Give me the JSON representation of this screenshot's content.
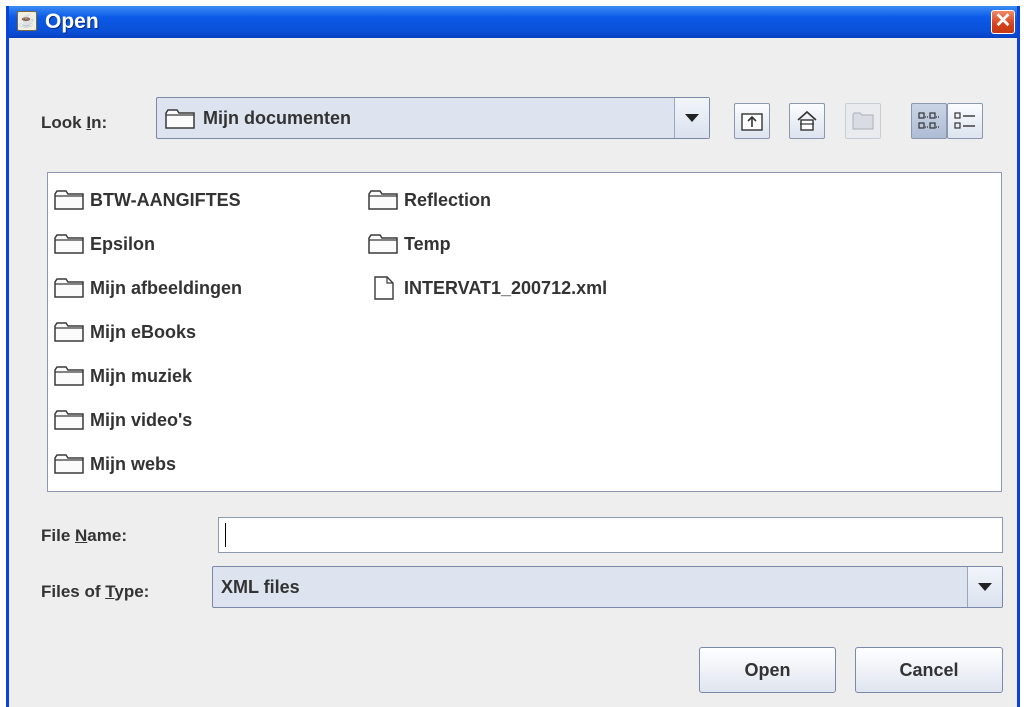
{
  "window": {
    "title": "Open"
  },
  "look_in": {
    "label_pre": "Look ",
    "label_mnemonic": "I",
    "label_post": "n:",
    "value": "Mijn documenten"
  },
  "toolbar": [
    {
      "name": "up-one-level",
      "icon": "up-folder-icon",
      "enabled": true,
      "selected": false
    },
    {
      "name": "home",
      "icon": "home-icon",
      "enabled": true,
      "selected": false
    },
    {
      "name": "new-folder",
      "icon": "new-folder-icon",
      "enabled": false,
      "selected": false
    },
    {
      "name": "list-view",
      "icon": "list-view-icon",
      "enabled": true,
      "selected": true
    },
    {
      "name": "details-view",
      "icon": "details-view-icon",
      "enabled": true,
      "selected": false
    }
  ],
  "files": {
    "column1": [
      {
        "name": "BTW-AANGIFTES",
        "type": "folder"
      },
      {
        "name": "Epsilon",
        "type": "folder"
      },
      {
        "name": "Mijn afbeeldingen",
        "type": "folder"
      },
      {
        "name": "Mijn eBooks",
        "type": "folder"
      },
      {
        "name": "Mijn muziek",
        "type": "folder"
      },
      {
        "name": "Mijn video's",
        "type": "folder"
      },
      {
        "name": "Mijn webs",
        "type": "folder"
      }
    ],
    "column2": [
      {
        "name": "Reflection",
        "type": "folder"
      },
      {
        "name": "Temp",
        "type": "folder"
      },
      {
        "name": "INTERVAT1_200712.xml",
        "type": "file"
      }
    ]
  },
  "file_name": {
    "label_pre": "File ",
    "label_mnemonic": "N",
    "label_post": "ame:",
    "value": "",
    "placeholder": ""
  },
  "file_type": {
    "label_pre": "Files of ",
    "label_mnemonic": "T",
    "label_post": "ype:",
    "value": "XML files"
  },
  "buttons": {
    "open": "Open",
    "cancel": "Cancel"
  },
  "colors": {
    "title_bar": "#0a4fd6",
    "dialog_bg": "#eeeeee",
    "close_button": "#d6401a"
  }
}
